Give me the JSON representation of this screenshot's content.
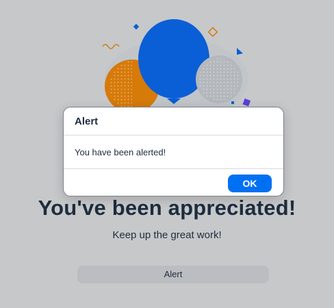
{
  "page": {
    "headline": "You've been appreciated!",
    "subline": "Keep up the great work!",
    "alert_button_label": "Alert"
  },
  "illustration": {
    "icon": "balloons-illustration",
    "colors": {
      "blue_balloon": "#0a5fd6",
      "orange_balloon": "#d67a0a",
      "grey_balloon": "#b4b8bd",
      "confetti_blue": "#0a5fd6",
      "confetti_orange": "#d67a0a",
      "confetti_purple": "#5b3fd9"
    }
  },
  "dialog": {
    "title": "Alert",
    "message": "You have been alerted!",
    "ok_label": "OK"
  },
  "colors": {
    "background": "#c7c8ca",
    "accent": "#0070f2",
    "text": "#1d2d3e"
  }
}
